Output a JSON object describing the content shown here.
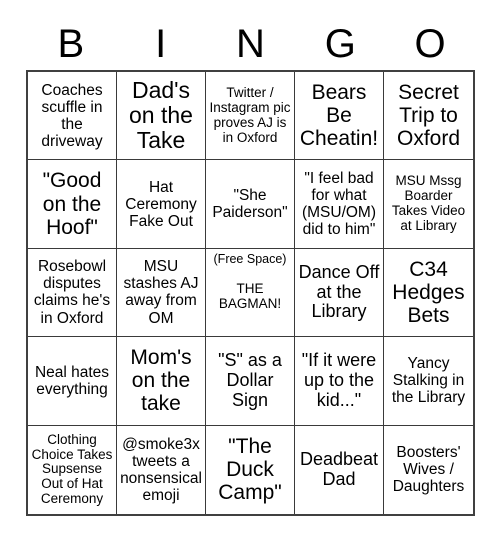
{
  "header": {
    "letters": [
      "B",
      "I",
      "N",
      "G",
      "O"
    ]
  },
  "grid": {
    "rows": 5,
    "columns": 5,
    "border_color": "#404040",
    "background_color": "#ffffff",
    "text_color": "#000000"
  },
  "cells": [
    {
      "id": "b1",
      "text": "Coaches scuffle in the driveway",
      "size": "m"
    },
    {
      "id": "i1",
      "text": "Dad's on the Take",
      "size": "xxl"
    },
    {
      "id": "n1",
      "text": "Twitter / Instagram pic proves AJ is in Oxford",
      "size": "s"
    },
    {
      "id": "g1",
      "text": "Bears Be Cheatin!",
      "size": "xl"
    },
    {
      "id": "o1",
      "text": "Secret Trip to Oxford",
      "size": "xl"
    },
    {
      "id": "b2",
      "text": "\"Good on the Hoof\"",
      "size": "xl"
    },
    {
      "id": "i2",
      "text": "Hat Ceremony Fake Out",
      "size": "m"
    },
    {
      "id": "n2",
      "text": "\"She Paiderson\"",
      "size": "m"
    },
    {
      "id": "g2",
      "text": "\"I feel bad for what (MSU/OM) did to him\"",
      "size": "m"
    },
    {
      "id": "o2",
      "text": "MSU Mssg Boarder Takes Video at Library",
      "size": "s"
    },
    {
      "id": "b3",
      "text": "Rosebowl disputes claims he's in Oxford",
      "size": "m"
    },
    {
      "id": "i3",
      "text": "MSU stashes AJ away from OM",
      "size": "m"
    },
    {
      "id": "n3",
      "free_space": true,
      "free_label": "(Free Space)",
      "text": "THE BAGMAN!",
      "size": "s"
    },
    {
      "id": "g3",
      "text": "Dance Off at the Library",
      "size": "l"
    },
    {
      "id": "o3",
      "text": "C34 Hedges Bets",
      "size": "xl"
    },
    {
      "id": "b4",
      "text": "Neal hates everything",
      "size": "m"
    },
    {
      "id": "i4",
      "text": "Mom's on the take",
      "size": "xl"
    },
    {
      "id": "n4",
      "text": "\"S\" as a Dollar Sign",
      "size": "l"
    },
    {
      "id": "g4",
      "text": "\"If it were up to the kid...\"",
      "size": "l"
    },
    {
      "id": "o4",
      "text": "Yancy Stalking in the Library",
      "size": "m"
    },
    {
      "id": "b5",
      "text": "Clothing Choice Takes Supsense Out of Hat Ceremony",
      "size": "s"
    },
    {
      "id": "i5",
      "text": "@smoke3x tweets a nonsensical emoji",
      "size": "m"
    },
    {
      "id": "n5",
      "text": "\"The Duck Camp\"",
      "size": "xl"
    },
    {
      "id": "g5",
      "text": "Deadbeat Dad",
      "size": "l"
    },
    {
      "id": "o5",
      "text": "Boosters' Wives / Daughters",
      "size": "m"
    }
  ]
}
